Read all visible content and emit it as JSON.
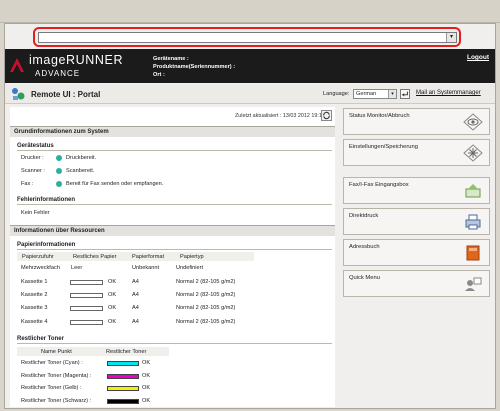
{
  "header": {
    "brand_line1": "imageRUNNER",
    "brand_line2": "ADVANCE",
    "device_name_label": "Gerätename :",
    "product_name_label": "Produktname(Seriennummer) :",
    "location_label": "Ort :",
    "logout": "Logout"
  },
  "titlebar": {
    "title": "Remote UI : Portal",
    "language_label": "Language:",
    "language_value": "German",
    "mail_admin": "Mail an Systemmanager"
  },
  "main": {
    "updated": "Zuletzt aktualisiert : 13/03 2012 19:14:28",
    "basic_info_title": "Grundinformationen zum System",
    "device_status_title": "Gerätestatus",
    "status_rows": [
      {
        "label": "Drucker :",
        "value": "Druckbereit."
      },
      {
        "label": "Scanner :",
        "value": "Scanbereit."
      },
      {
        "label": "Fax :",
        "value": "Bereit für Fax senden oder empfangen."
      }
    ],
    "error_info_title": "Fehlerinformationen",
    "error_value": "Kein Fehler",
    "resources_title": "Informationen über Ressourcen",
    "paper_info_title": "Papierinformationen",
    "paper_headers": [
      "Papierzufuhr",
      "Restliches Papier",
      "Papierformat",
      "Papiertyp"
    ],
    "paper_rows": [
      {
        "source": "Mehrzweckfach",
        "remaining": "Leer",
        "format": "Unbekannt",
        "type": "Undefiniert",
        "bar": false
      },
      {
        "source": "Kassette 1",
        "remaining": "OK",
        "format": "A4",
        "type": "Normal 2 (82-105 g/m2)",
        "bar": true
      },
      {
        "source": "Kassette 2",
        "remaining": "OK",
        "format": "A4",
        "type": "Normal 2 (82-105 g/m2)",
        "bar": true
      },
      {
        "source": "Kassette 3",
        "remaining": "OK",
        "format": "A4",
        "type": "Normal 2 (82-105 g/m2)",
        "bar": true
      },
      {
        "source": "Kassette 4",
        "remaining": "OK",
        "format": "A4",
        "type": "Normal 2 (82-105 g/m2)",
        "bar": true
      }
    ],
    "toner_title": "Restlicher Toner",
    "toner_headers": [
      "Name Punkt",
      "Restlicher Toner"
    ],
    "toner_rows": [
      {
        "name": "Restlicher Toner (Cyan) :",
        "value": "OK",
        "color": "#00e5ee"
      },
      {
        "name": "Restlicher Toner (Magenta) :",
        "value": "OK",
        "color": "#ee00c8"
      },
      {
        "name": "Restlicher Toner (Gelb) :",
        "value": "OK",
        "color": "#f2f200"
      },
      {
        "name": "Restlicher Toner (Schwarz) :",
        "value": "OK",
        "color": "#000000"
      }
    ]
  },
  "menu": [
    {
      "label": "Status Monitor/Abbruch",
      "icon": "eye-icon"
    },
    {
      "label": "Einstellungen/Speicherung",
      "icon": "settings-icon"
    },
    {
      "label": "Fax/I-Fax Eingangsbox",
      "icon": "fax-inbox-icon"
    },
    {
      "label": "Direktdruck",
      "icon": "printer-icon"
    },
    {
      "label": "Adressbuch",
      "icon": "address-book-icon"
    },
    {
      "label": "Quick Menu",
      "icon": "quick-menu-icon"
    }
  ]
}
